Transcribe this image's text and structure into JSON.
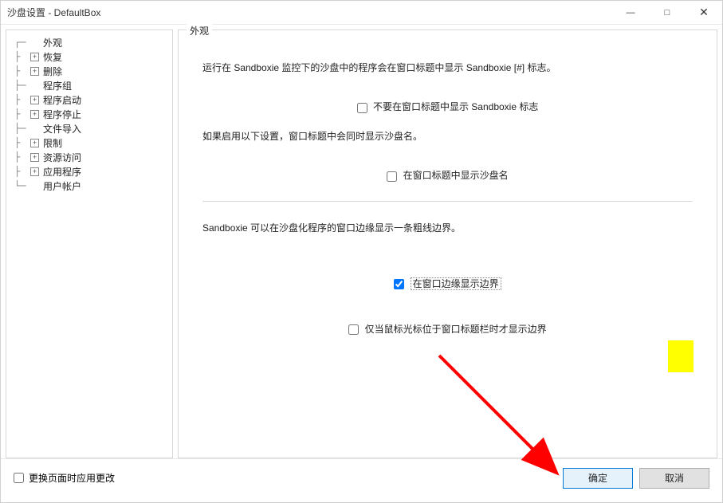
{
  "window": {
    "title": "沙盘设置 - DefaultBox",
    "minimize": "—",
    "maximize": "□",
    "close": "✕"
  },
  "sidebar": {
    "items": [
      {
        "label": "外观",
        "expandable": false,
        "selected": true
      },
      {
        "label": "恢复",
        "expandable": true
      },
      {
        "label": "删除",
        "expandable": true
      },
      {
        "label": "程序组",
        "expandable": false
      },
      {
        "label": "程序启动",
        "expandable": true
      },
      {
        "label": "程序停止",
        "expandable": true
      },
      {
        "label": "文件导入",
        "expandable": false
      },
      {
        "label": "限制",
        "expandable": true
      },
      {
        "label": "资源访问",
        "expandable": true
      },
      {
        "label": "应用程序",
        "expandable": true
      },
      {
        "label": "用户帐户",
        "expandable": false
      }
    ]
  },
  "content": {
    "group_title": "外观",
    "desc1": "运行在 Sandboxie 监控下的沙盘中的程序会在窗口标题中显示 Sandboxie [#] 标志。",
    "checkbox1_label": "不要在窗口标题中显示 Sandboxie 标志",
    "checkbox1_checked": false,
    "desc2": "如果启用以下设置，窗口标题中会同时显示沙盘名。",
    "checkbox2_label": "在窗口标题中显示沙盘名",
    "checkbox2_checked": false,
    "desc3": "Sandboxie 可以在沙盘化程序的窗口边缘显示一条粗线边界。",
    "checkbox3_label": "在窗口边缘显示边界",
    "checkbox3_checked": true,
    "checkbox4_label": "仅当鼠标光标位于窗口标题栏时才显示边界",
    "checkbox4_checked": false
  },
  "bottombar": {
    "apply_on_change_label": "更换页面时应用更改",
    "apply_on_change_checked": false,
    "ok_label": "确定",
    "cancel_label": "取消"
  },
  "icons": {
    "plus": "+"
  }
}
